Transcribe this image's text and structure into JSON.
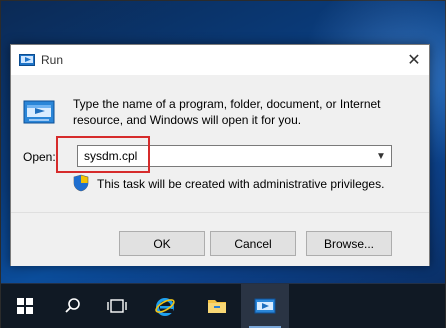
{
  "dialog": {
    "title": "Run",
    "description": "Type the name of a program, folder, document, or Internet resource, and Windows will open it for you.",
    "open_label": "Open:",
    "open_value": "sysdm.cpl",
    "admin_note": "This task will be created with administrative privileges.",
    "buttons": {
      "ok": "OK",
      "cancel": "Cancel",
      "browse": "Browse..."
    },
    "close_glyph": "✕"
  },
  "taskbar": {
    "items": [
      {
        "icon": "windows-start-icon"
      },
      {
        "icon": "search-icon"
      },
      {
        "icon": "task-view-icon"
      },
      {
        "icon": "internet-explorer-icon"
      },
      {
        "icon": "file-explorer-icon"
      },
      {
        "icon": "run-app-icon"
      }
    ]
  },
  "colors": {
    "highlight": "#d62b2b",
    "desktop": "#0b4d9b",
    "taskbar": "#101924"
  }
}
